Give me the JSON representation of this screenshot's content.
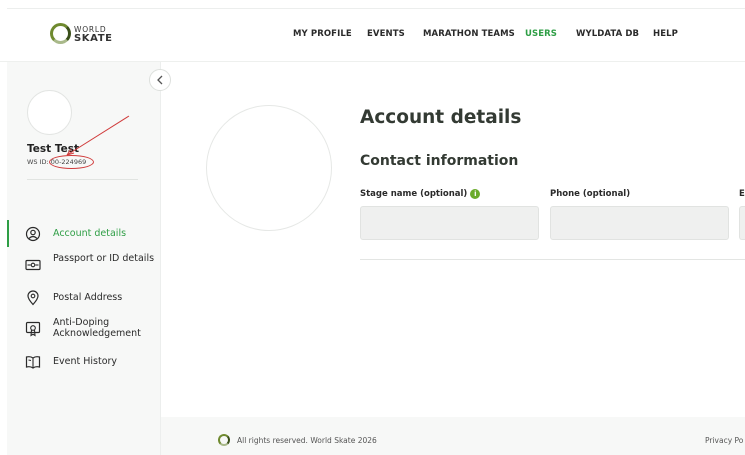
{
  "brand": {
    "line1": "WORLD",
    "line2": "SKATE"
  },
  "nav": {
    "items": [
      {
        "label": "MY PROFILE",
        "active": false
      },
      {
        "label": "EVENTS",
        "active": false
      },
      {
        "label": "MARATHON TEAMS",
        "active": false
      },
      {
        "label": "USERS",
        "active": true
      },
      {
        "label": "WYLDATA DB",
        "active": false
      },
      {
        "label": "HELP",
        "active": false
      }
    ]
  },
  "user": {
    "name": "Test Test",
    "ws_id": "WS ID: 00-224969"
  },
  "sidebar": {
    "items": [
      {
        "label": "Account details",
        "icon": "user-circle-icon",
        "active": true
      },
      {
        "label": "Passport or ID details",
        "icon": "id-card-icon",
        "active": false
      },
      {
        "label": "Postal Address",
        "icon": "location-pin-icon",
        "active": false
      },
      {
        "label": "Anti-Doping Acknowledgement",
        "icon": "certificate-icon",
        "active": false
      },
      {
        "label": "Event History",
        "icon": "book-icon",
        "active": false
      }
    ]
  },
  "main": {
    "title": "Account details",
    "section": "Contact information",
    "fields": [
      {
        "label": "Stage name (optional)",
        "value": "",
        "has_info": true
      },
      {
        "label": "Phone (optional)",
        "value": "",
        "has_info": false
      },
      {
        "label": "E",
        "value": "",
        "has_info": false
      }
    ]
  },
  "footer": {
    "copyright": "All rights reserved. World Skate 2026",
    "link": "Privacy Po"
  },
  "colors": {
    "accent": "#2e9e45",
    "annotation": "#d03b3b"
  }
}
